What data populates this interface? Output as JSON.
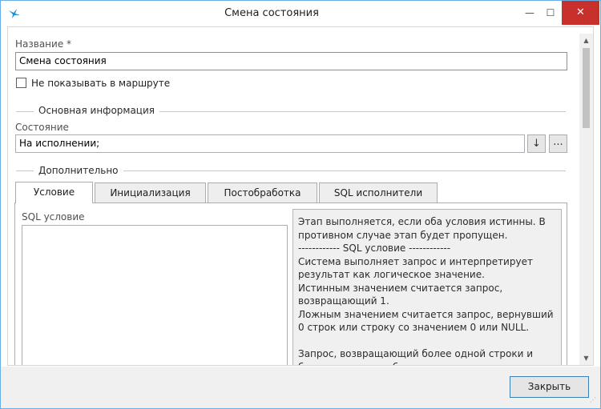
{
  "window": {
    "title": "Смена состояния",
    "min_glyph": "—",
    "max_glyph": "☐",
    "close_glyph": "✕",
    "accent": "#3a96dd",
    "close_hover_color": "#c7302b"
  },
  "form": {
    "name_label": "Название  *",
    "name_value": "Смена состояния",
    "hide_in_route_label": "Не показывать в маршруте",
    "hide_in_route_checked": false,
    "main_group_title": "Основная информация",
    "state_label": "Состояние",
    "state_value": "На исполнении;",
    "state_select_glyph": "↓",
    "state_more_glyph": "...",
    "extra_group_title": "Дополнительно"
  },
  "tabs": [
    {
      "label": "Условие",
      "active": true
    },
    {
      "label": "Инициализация",
      "active": false
    },
    {
      "label": "Постобработка",
      "active": false
    },
    {
      "label": "SQL исполнители",
      "active": false
    }
  ],
  "condition_tab": {
    "sql_label": "SQL условие",
    "sql_value": "",
    "help_text": "Этап выполняется, если оба условия истинны. В противном случае этап будет пропущен.\n------------ SQL условие ------------\nСистема выполняет запрос и интерпретирует результат как логическое значение.\nИстинным значением считается запрос, возвращающий 1.\nЛожным значением считается запрос, вернувший 0 строк или строку со значением 0 или NULL.\n\nЗапрос, возвращающий более одной строки и более одного столбца, является некорректным."
  },
  "footer": {
    "close_label": "Закрыть"
  },
  "icons": {
    "app": "bird-logo-icon",
    "scroll_up": "chevron-up-icon",
    "scroll_down": "chevron-down-icon",
    "resize": "resize-grip-icon"
  }
}
